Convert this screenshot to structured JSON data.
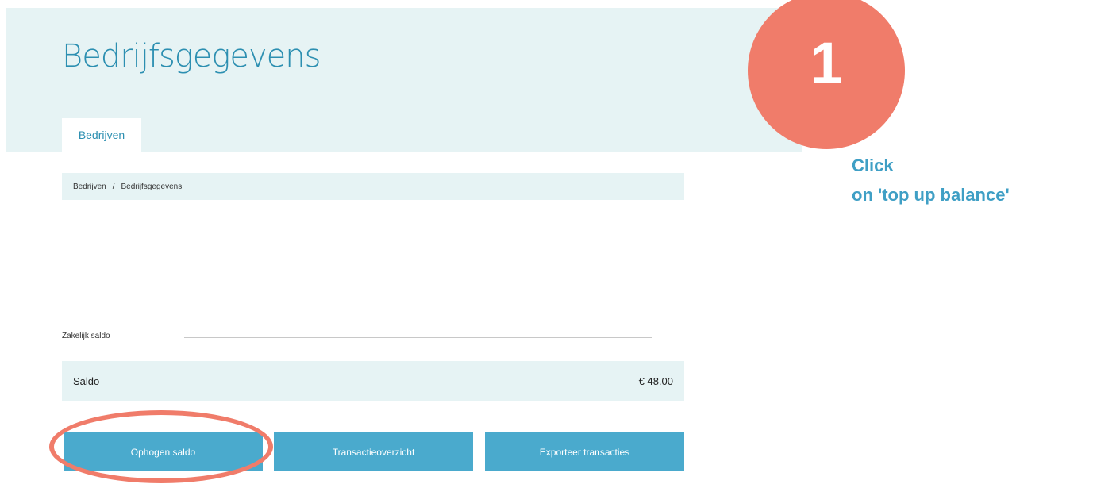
{
  "header": {
    "title": "Bedrijfsgegevens",
    "tab_label": "Bedrijven"
  },
  "breadcrumb": {
    "link": "Bedrijven",
    "separator": "/",
    "current": "Bedrijfsgegevens"
  },
  "balance_section": {
    "label": "Zakelijk saldo",
    "saldo_label": "Saldo",
    "saldo_value": "€ 48.00"
  },
  "actions": {
    "top_up": "Ophogen saldo",
    "transactions": "Transactieoverzicht",
    "export": "Exporteer transacties"
  },
  "annotation": {
    "step_number": "1",
    "line1": "Click",
    "line2": "on 'top up balance'"
  },
  "colors": {
    "accent": "#4aaacd",
    "header_bg": "#e6f3f4",
    "annotation": "#f07c6a",
    "instruction_text": "#3f9fc5"
  }
}
